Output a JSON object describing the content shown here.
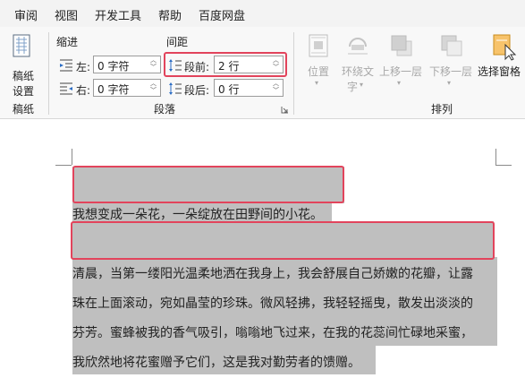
{
  "menu": {
    "items": [
      "审阅",
      "视图",
      "开发工具",
      "帮助",
      "百度网盘"
    ]
  },
  "ribbon": {
    "manuscript": {
      "button_label_1": "稿纸",
      "button_label_2": "设置",
      "group_label": "稿纸"
    },
    "indent": {
      "heading": "缩进",
      "left_label": "左:",
      "left_value": "0 字符",
      "right_label": "右:",
      "right_value": "0 字符"
    },
    "spacing": {
      "heading": "间距",
      "before_label": "段前:",
      "before_value": "2 行",
      "after_label": "段后:",
      "after_value": "0 行"
    },
    "paragraph_group_label": "段落",
    "arrange": {
      "position_label": "位置",
      "wrap_label_1": "环绕文",
      "wrap_label_2": "字",
      "bring_forward_label": "上移一层",
      "send_backward_label": "下移一层",
      "selection_pane_label": "选择窗格",
      "group_label": "排列"
    }
  },
  "document": {
    "lines": [
      "我想变成一朵花，一朵绽放在田野间的小花。",
      "清晨，当第一缕阳光温柔地洒在我身上，我会舒展自己娇嫩的花瓣，让露",
      "珠在上面滚动，宛如晶莹的珍珠。微风轻拂，我轻轻摇曳，散发出淡淡的",
      "芬芳。蜜蜂被我的香气吸引，嗡嗡地飞过来，在我的花蕊间忙碌地采蜜，",
      "我欣然地将花蜜赠予它们，这是我对勤劳者的馈赠。"
    ]
  },
  "colors": {
    "highlight_border": "#e2445c",
    "selection": "#bfbfbf"
  }
}
